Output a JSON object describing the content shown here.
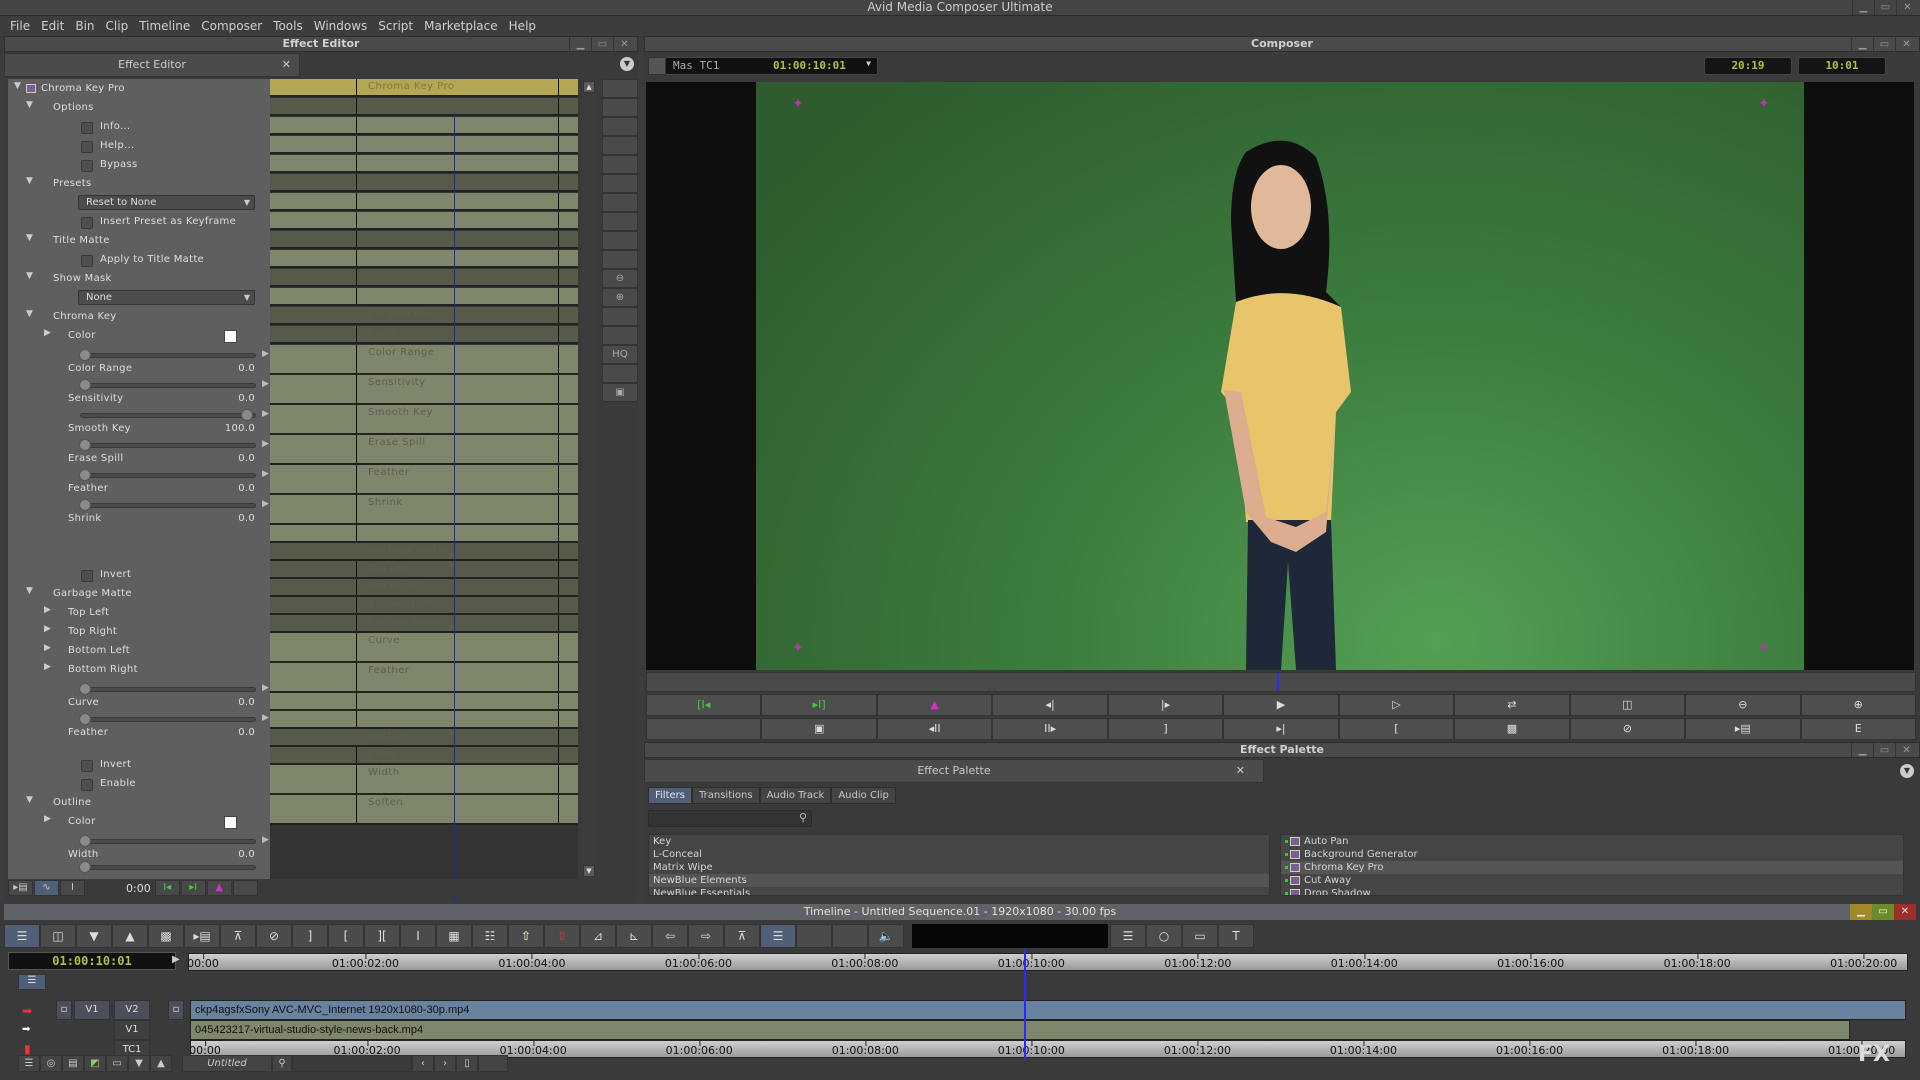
{
  "app": {
    "title": "Avid Media Composer Ultimate"
  },
  "menu": [
    "File",
    "Edit",
    "Bin",
    "Clip",
    "Timeline",
    "Composer",
    "Tools",
    "Windows",
    "Script",
    "Marketplace",
    "Help"
  ],
  "effect_editor": {
    "window_title": "Effect Editor",
    "tab_label": "Effect Editor",
    "effect_name": "Chroma Key Pro",
    "groups": {
      "options": "Options",
      "info": "Info...",
      "help": "Help...",
      "bypass": "Bypass",
      "presets": "Presets",
      "preset_select": "Reset to None",
      "insert_preset": "Insert Preset as Keyframe",
      "title_matte": "Title Matte",
      "apply_title_matte": "Apply to Title Matte",
      "show_mask": "Show Mask",
      "mask_select": "None",
      "chroma_key": "Chroma Key",
      "color": "Color",
      "invert": "Invert",
      "garbage_matte": "Garbage Matte",
      "top_left": "Top Left",
      "top_right": "Top Right",
      "bottom_left": "Bottom Left",
      "bottom_right": "Bottom Right",
      "enable": "Enable",
      "outline": "Outline",
      "soften": "Soften"
    },
    "sliders": {
      "color_range": {
        "label": "Color Range",
        "value": "0.0",
        "fraction": 0
      },
      "sensitivity": {
        "label": "Sensitivity",
        "value": "0.0",
        "fraction": 0
      },
      "smooth_key": {
        "label": "Smooth Key",
        "value": "100.0",
        "fraction": 1
      },
      "erase_spill": {
        "label": "Erase Spill",
        "value": "0.0",
        "fraction": 0
      },
      "feather": {
        "label": "Feather",
        "value": "0.0",
        "fraction": 0
      },
      "shrink": {
        "label": "Shrink",
        "value": "0.0",
        "fraction": 0
      },
      "curve": {
        "label": "Curve",
        "value": "0.0",
        "fraction": 0
      },
      "gm_feather": {
        "label": "Feather",
        "value": "0.0",
        "fraction": 0
      },
      "width": {
        "label": "Width",
        "value": "0.0",
        "fraction": 0
      }
    },
    "side_buttons": {
      "hq": "HQ"
    },
    "footer_time": "0:00"
  },
  "composer": {
    "window_title": "Composer",
    "track_name": "Mas TC1",
    "timecode": "01:00:10:01",
    "counter_1": "20:19",
    "counter_2": "10:01"
  },
  "effect_palette": {
    "window_title": "Effect Palette",
    "tab_label": "Effect Palette",
    "tabs": [
      "Filters",
      "Transitions",
      "Audio Track",
      "Audio Clip"
    ],
    "active_tab": "Filters",
    "search_placeholder": "",
    "categories": [
      "Key",
      "L-Conceal",
      "Matrix Wipe",
      "NewBlue Elements",
      "NewBlue Essentials"
    ],
    "effects": [
      "Auto Pan",
      "Background Generator",
      "Chroma Key Pro",
      "Cut Away",
      "Drop Shadow"
    ]
  },
  "timeline": {
    "title": "Timeline - Untitled Sequence.01 - 1920x1080 - 30.00 fps",
    "timecode": "01:00:10:01",
    "ruler_ticks": [
      "00:00",
      "01:00:02:00",
      "01:00:04:00",
      "01:00:06:00",
      "01:00:08:00",
      "01:00:10:00",
      "01:00:12:00",
      "01:00:14:00",
      "01:00:16:00",
      "01:00:18:00",
      "01:00:20:00"
    ],
    "tracks": {
      "v2": {
        "label": "V2",
        "source": "V1",
        "clip": "ckp4agsfxSony AVC-MVC_Internet 1920x1080-30p.mp4"
      },
      "v1": {
        "label": "V1",
        "clip": "045423217-virtual-studio-style-news-back.mp4"
      },
      "tc1": {
        "label": "TC1"
      }
    },
    "bin_select": "Untitled"
  }
}
